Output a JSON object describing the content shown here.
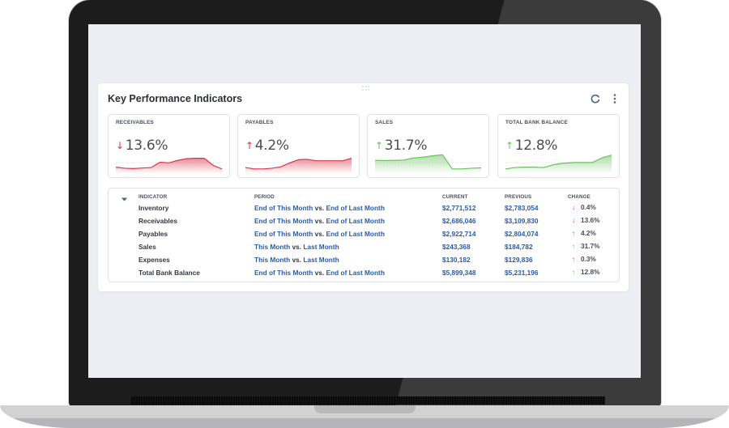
{
  "widget": {
    "title": "Key Performance Indicators",
    "actions": [
      {
        "name": "refresh",
        "icon": "refresh-icon"
      },
      {
        "name": "more",
        "icon": "more-vertical-icon"
      }
    ]
  },
  "colors": {
    "negative": "#d9344a",
    "positive": "#6cc060",
    "link": "#2a5aa8",
    "text": "#33373d"
  },
  "tiles": [
    {
      "label": "RECEIVABLES",
      "direction": "down",
      "arrow": "↓",
      "value": "13.6%",
      "tone": "negative",
      "sparkline": [
        0.2,
        0.14,
        0.12,
        0.15,
        0.18,
        0.48,
        0.44,
        0.58,
        0.68,
        0.7,
        0.7,
        0.3,
        0.1
      ]
    },
    {
      "label": "PAYABLES",
      "direction": "up",
      "arrow": "↑",
      "value": "4.2%",
      "tone": "negative",
      "sparkline": [
        0.18,
        0.1,
        0.1,
        0.14,
        0.22,
        0.44,
        0.62,
        0.64,
        0.56,
        0.56,
        0.56,
        0.56,
        0.7
      ]
    },
    {
      "label": "SALES",
      "direction": "up",
      "arrow": "↑",
      "value": "31.7%",
      "tone": "positive",
      "sparkline": [
        0.58,
        0.57,
        0.58,
        0.6,
        0.72,
        0.76,
        0.84,
        0.9,
        0.1,
        0.1,
        0.14,
        0.16
      ]
    },
    {
      "label": "TOTAL BANK BALANCE",
      "direction": "up",
      "arrow": "↑",
      "value": "12.8%",
      "tone": "positive",
      "sparkline": [
        0.1,
        0.18,
        0.2,
        0.2,
        0.18,
        0.34,
        0.42,
        0.46,
        0.46,
        0.46,
        0.72,
        0.88
      ]
    }
  ],
  "table": {
    "columns": [
      "INDICATOR",
      "PERIOD",
      "CURRENT",
      "PREVIOUS",
      "CHANGE"
    ],
    "vs_label": "vs.",
    "rows": [
      {
        "indicator": "Inventory",
        "period_a": "End of This Month",
        "period_b": "End of Last Month",
        "current": "$2,771,512",
        "previous": "$2,783,054",
        "change_arrow": "↓",
        "change": "0.4%",
        "tone": "negative"
      },
      {
        "indicator": "Receivables",
        "period_a": "End of This Month",
        "period_b": "End of Last Month",
        "current": "$2,686,046",
        "previous": "$3,109,830",
        "change_arrow": "↓",
        "change": "13.6%",
        "tone": "negative"
      },
      {
        "indicator": "Payables",
        "period_a": "End of This Month",
        "period_b": "End of Last Month",
        "current": "$2,922,714",
        "previous": "$2,804,074",
        "change_arrow": "↑",
        "change": "4.2%",
        "tone": "negative"
      },
      {
        "indicator": "Sales",
        "period_a": "This Month",
        "period_b": "Last Month",
        "current": "$243,368",
        "previous": "$184,782",
        "change_arrow": "↑",
        "change": "31.7%",
        "tone": "positive"
      },
      {
        "indicator": "Expenses",
        "period_a": "This Month",
        "period_b": "Last Month",
        "current": "$130,182",
        "previous": "$129,836",
        "change_arrow": "↑",
        "change": "0.3%",
        "tone": "negative"
      },
      {
        "indicator": "Total Bank Balance",
        "period_a": "End of This Month",
        "period_b": "End of Last Month",
        "current": "$5,899,348",
        "previous": "$5,231,196",
        "change_arrow": "↑",
        "change": "12.8%",
        "tone": "positive"
      }
    ]
  }
}
